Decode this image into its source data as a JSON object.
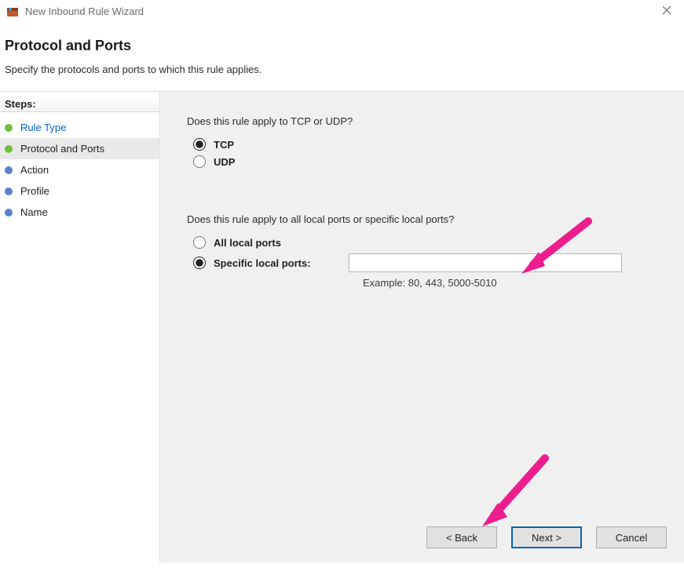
{
  "window": {
    "title": "New Inbound Rule Wizard"
  },
  "header": {
    "title": "Protocol and Ports",
    "subtitle": "Specify the protocols and ports to which this rule applies."
  },
  "sidebar": {
    "heading": "Steps:",
    "items": [
      {
        "label": "Rule Type",
        "bullet": "green",
        "link": true,
        "activeRow": false
      },
      {
        "label": "Protocol and Ports",
        "bullet": "green",
        "link": false,
        "activeRow": true
      },
      {
        "label": "Action",
        "bullet": "blue",
        "link": false,
        "activeRow": false
      },
      {
        "label": "Profile",
        "bullet": "blue",
        "link": false,
        "activeRow": false
      },
      {
        "label": "Name",
        "bullet": "blue",
        "link": false,
        "activeRow": false
      }
    ]
  },
  "content": {
    "protocol_question": "Does this rule apply to TCP or UDP?",
    "protocol_options": {
      "tcp": "TCP",
      "udp": "UDP",
      "selected": "tcp"
    },
    "ports_question": "Does this rule apply to all local ports or specific local ports?",
    "port_options": {
      "all": "All local ports",
      "specific": "Specific local ports:",
      "selected": "specific"
    },
    "port_input_value": "",
    "port_example": "Example: 80, 443, 5000-5010"
  },
  "buttons": {
    "back": "< Back",
    "next": "Next >",
    "cancel": "Cancel"
  }
}
